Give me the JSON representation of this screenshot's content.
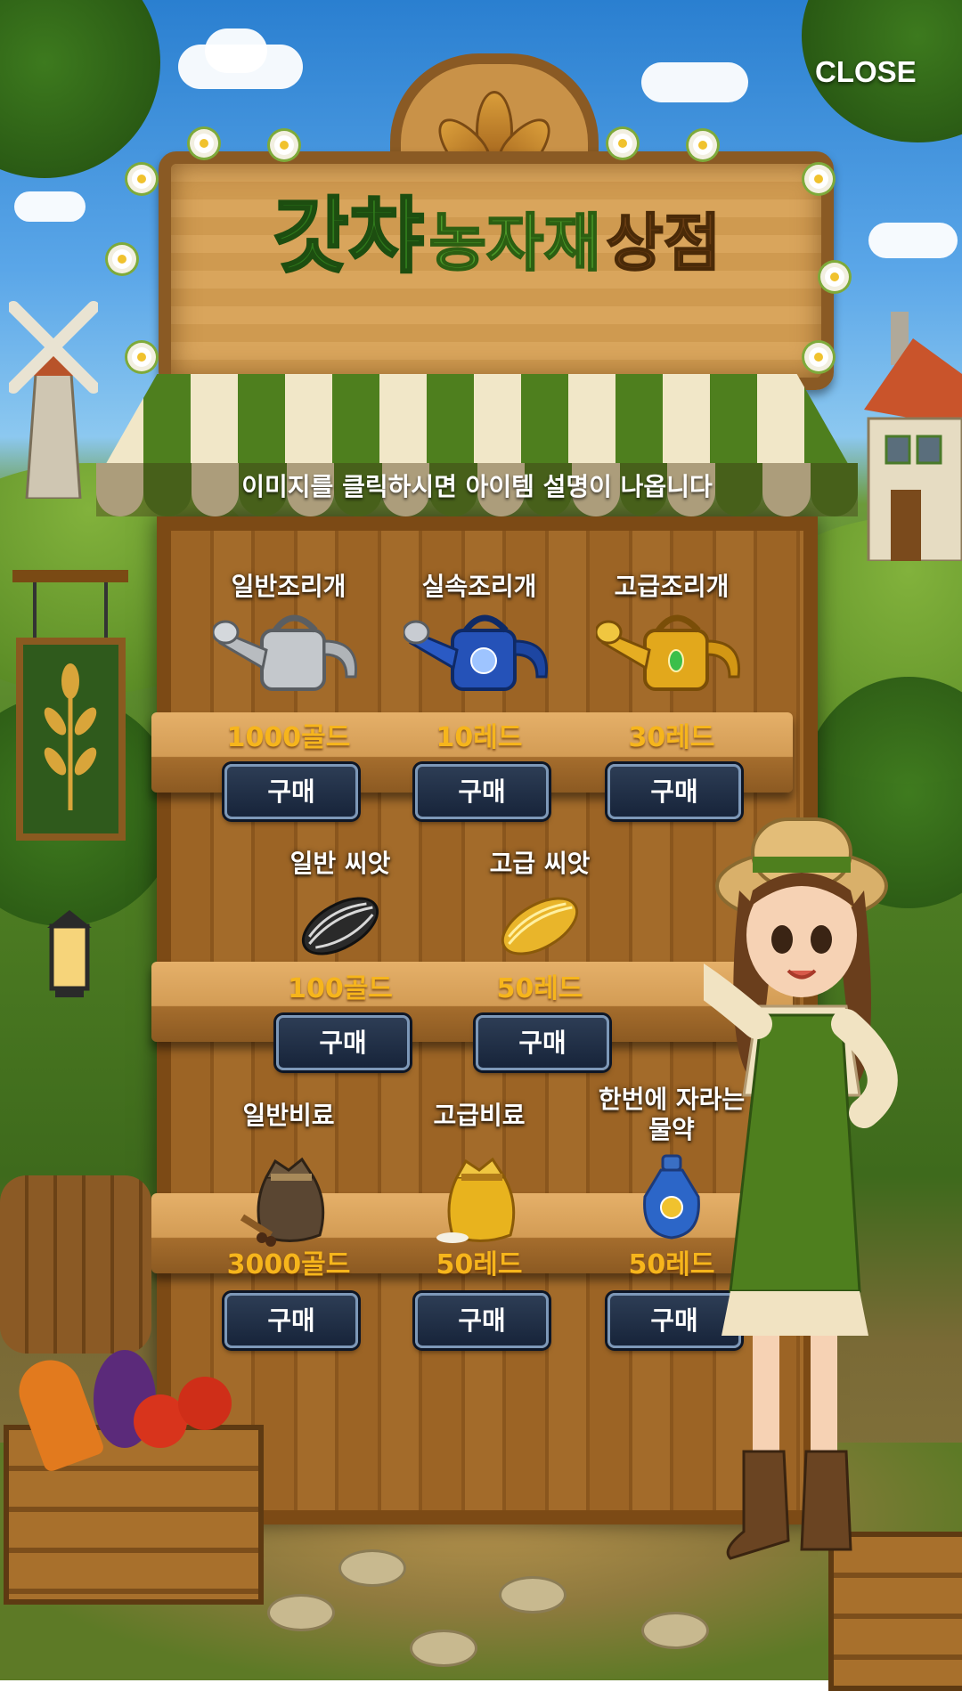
{
  "header": {
    "close_label": "CLOSE"
  },
  "sign": {
    "title_part1": "갓챠",
    "title_part2": "농자재",
    "title_part3": "상점"
  },
  "instruction": "이미지를 클릭하시면 아이템 설명이 나옵니다",
  "shelves": [
    {
      "items": [
        {
          "name": "일반조리개",
          "price": "1000골드",
          "buy_label": "구매",
          "icon": "silver-watering-can-icon"
        },
        {
          "name": "실속조리개",
          "price": "10레드",
          "buy_label": "구매",
          "icon": "blue-watering-can-icon"
        },
        {
          "name": "고급조리개",
          "price": "30레드",
          "buy_label": "구매",
          "icon": "gold-watering-can-icon"
        }
      ]
    },
    {
      "items": [
        {
          "name": "일반 씨앗",
          "price": "100골드",
          "buy_label": "구매",
          "icon": "sunflower-seed-icon"
        },
        {
          "name": "고급 씨앗",
          "price": "50레드",
          "buy_label": "구매",
          "icon": "golden-seed-icon"
        }
      ]
    },
    {
      "items": [
        {
          "name": "일반비료",
          "price": "3000골드",
          "buy_label": "구매",
          "icon": "fertilizer-sack-icon"
        },
        {
          "name": "고급비료",
          "price": "50레드",
          "buy_label": "구매",
          "icon": "golden-fertilizer-sack-icon"
        },
        {
          "name": "한번에 자라는 물약",
          "price": "50레드",
          "buy_label": "구매",
          "icon": "growth-potion-icon"
        }
      ]
    }
  ],
  "colors": {
    "price": "#f6b51c",
    "button_bg": "#1f2d44",
    "title_green": "#2f7a1c",
    "title_brown": "#6a3e14"
  }
}
